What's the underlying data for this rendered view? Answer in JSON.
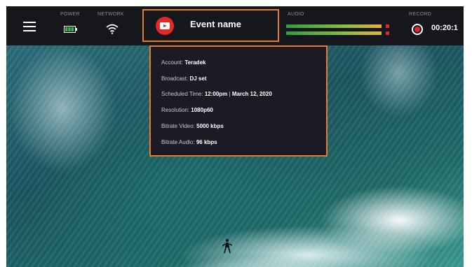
{
  "header": {
    "power_label": "POWER",
    "network_label": "NETWORK",
    "audio_label": "AUDIO",
    "record_label": "RECORD"
  },
  "event": {
    "name": "Event name",
    "platform_icon": "youtube-icon"
  },
  "status": {
    "battery_icon": "battery-icon",
    "network_icon": "wifi-icon"
  },
  "audio": {
    "channels": 2,
    "peak_color": "#e02a2a"
  },
  "record": {
    "time": "00:20:1"
  },
  "info": {
    "account_label": "Account:",
    "account_value": "Teradek",
    "broadcast_label": "Broadcast:",
    "broadcast_value": "DJ set",
    "scheduled_label": "Scheduled Time:",
    "scheduled_time": "12:00pm",
    "scheduled_date": "March 12, 2020",
    "resolution_label": "Resolution:",
    "resolution_value": "1080p60",
    "video_label": "Bitrate Video:",
    "video_value": "5000 kbps",
    "audio_label": "Bitrate Audio:",
    "audio_value": "96 kbps"
  },
  "colors": {
    "accent": "#e47d2e",
    "topbar": "#16171c",
    "panel": "#1c1b25",
    "youtube_red": "#e02a2a"
  }
}
